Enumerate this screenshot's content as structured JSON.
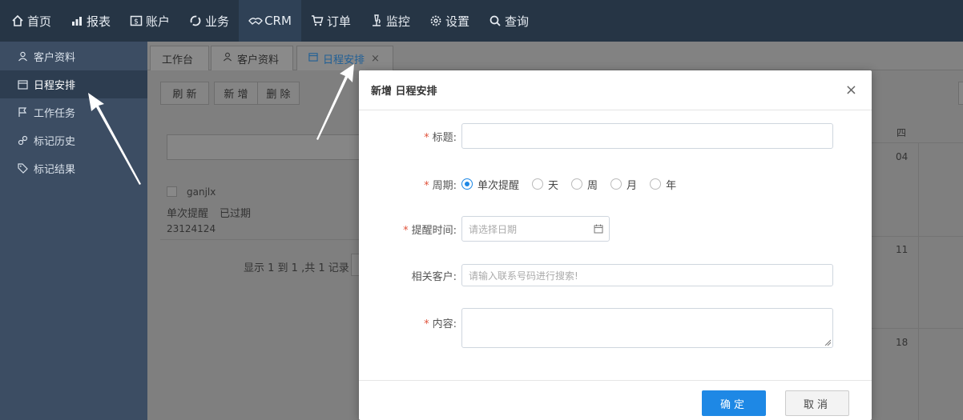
{
  "topnav": {
    "items": [
      {
        "label": "首页",
        "icon": "home-icon"
      },
      {
        "label": "报表",
        "icon": "chart-icon"
      },
      {
        "label": "账户",
        "icon": "money-icon"
      },
      {
        "label": "业务",
        "icon": "refresh-icon"
      },
      {
        "label": "CRM",
        "icon": "handshake-icon"
      },
      {
        "label": "订单",
        "icon": "cart-icon"
      },
      {
        "label": "监控",
        "icon": "microscope-icon"
      },
      {
        "label": "设置",
        "icon": "gear-icon"
      },
      {
        "label": "查询",
        "icon": "search-icon"
      }
    ]
  },
  "sidebar": {
    "items": [
      {
        "label": "客户资料",
        "icon": "user-icon"
      },
      {
        "label": "日程安排",
        "icon": "calendar-icon"
      },
      {
        "label": "工作任务",
        "icon": "flag-icon"
      },
      {
        "label": "标记历史",
        "icon": "link-icon"
      },
      {
        "label": "标记结果",
        "icon": "tag-icon"
      }
    ]
  },
  "tabs": [
    {
      "label": "工作台"
    },
    {
      "label": "客户资料"
    },
    {
      "label": "日程安排",
      "close": "×"
    }
  ],
  "toolbar": {
    "refresh": "刷 新",
    "add": "新 增",
    "delete": "删 除"
  },
  "list": {
    "name": "ganjlx",
    "type": "单次提醒",
    "status": "已过期",
    "content": "23124124",
    "pager": "显示 1 到 1 ,共 1 记录"
  },
  "calendar": {
    "weekday": "四",
    "dates": [
      "04",
      "11",
      "18"
    ]
  },
  "modal": {
    "title": "新增 日程安排",
    "close": "×",
    "fields": {
      "title_label": "标题:",
      "period_label": "周期:",
      "remind_label": "提醒时间:",
      "remind_placeholder": "请选择日期",
      "customer_label": "相关客户:",
      "customer_placeholder": "请输入联系号码进行搜索!",
      "content_label": "内容:"
    },
    "period_options": [
      "单次提醒",
      "天",
      "周",
      "月",
      "年"
    ],
    "selected_period": "单次提醒",
    "ok": "确定",
    "cancel": "取消"
  },
  "colors": {
    "accent": "#1e88e5",
    "nav_bg": "#263545",
    "sidebar_bg": "#3c4d63",
    "required": "#e0533b"
  }
}
